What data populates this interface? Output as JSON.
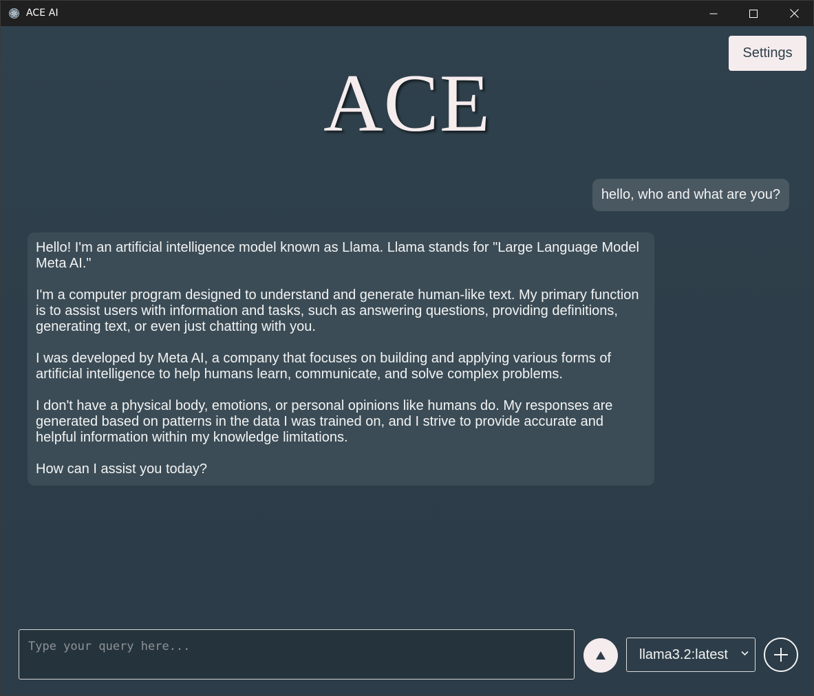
{
  "window": {
    "title": "ACE AI",
    "controls": [
      "minimize-icon",
      "maximize-icon",
      "close-icon"
    ]
  },
  "header": {
    "settings_label": "Settings",
    "logo_text": "ACE"
  },
  "chat": {
    "user_message": "hello, who and what are you?",
    "assistant_paragraphs": [
      "Hello! I'm an artificial intelligence model known as Llama. Llama stands for \"Large Language Model Meta AI.\"",
      "I'm a computer program designed to understand and generate human-like text. My primary function is to assist users with information and tasks, such as answering questions, providing definitions, generating text, or even just chatting with you.",
      "I was developed by Meta AI, a company that focuses on building and applying various forms of artificial intelligence to help humans learn, communicate, and solve complex problems.",
      "I don't have a physical body, emotions, or personal opinions like humans do. My responses are generated based on patterns in the data I was trained on, and I strive to provide accurate and helpful information within my knowledge limitations.",
      "How can I assist you today?"
    ]
  },
  "composer": {
    "placeholder": "Type your query here...",
    "value": "",
    "send_icon": "triangle-up-icon",
    "model_selected": "llama3.2:latest",
    "new_chat_icon": "plus-icon"
  },
  "colors": {
    "background": "#2d3e4a",
    "accent": "#f5ecee",
    "user_bubble": "#4a5862",
    "assistant_bubble": "#3b4c56",
    "input_background": "#25333c"
  }
}
